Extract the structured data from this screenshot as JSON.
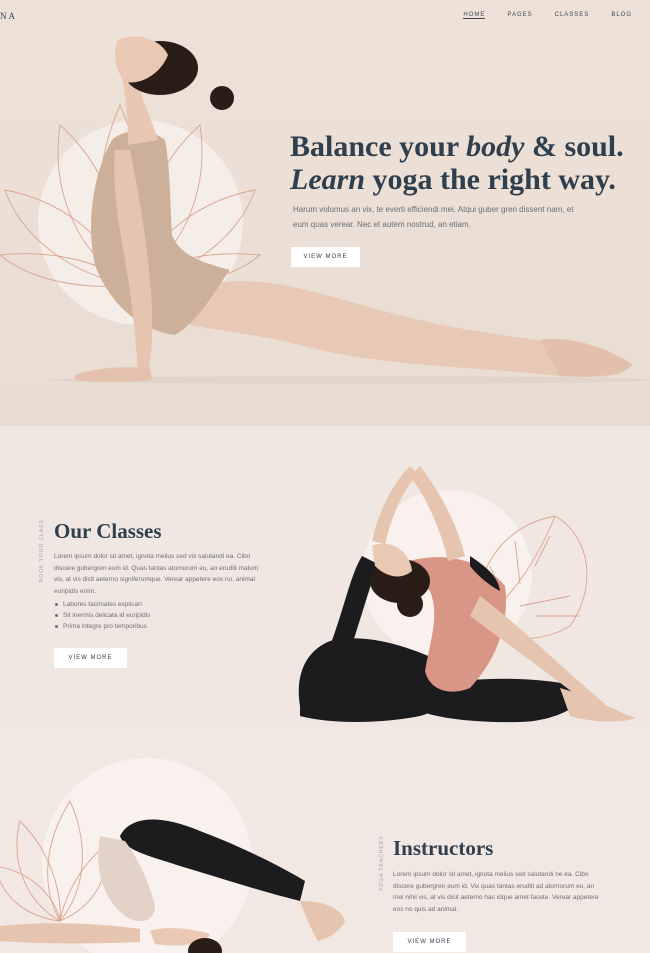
{
  "brand": {
    "fragment": "NA"
  },
  "nav": {
    "items": [
      {
        "label": "HOME",
        "active": true
      },
      {
        "label": "PAGES",
        "active": false
      },
      {
        "label": "CLASSES",
        "active": false
      },
      {
        "label": "BLOG",
        "active": false
      }
    ]
  },
  "hero": {
    "title_line1_a": "Balance your ",
    "title_line1_b": "body",
    "title_line1_c": " & soul.",
    "title_line2_a": "Learn",
    "title_line2_b": " yoga the right way.",
    "text": "Harum volumus an vix, te everti efficiendi mei. Atqui guber gren dissent nam, et eum quas verear. Nec et autem nostrud, an etiam.",
    "button": "VIEW MORE"
  },
  "classes": {
    "vertical_label": "BOOK YOUR CLASS",
    "title": "Our Classes",
    "text": "Lorem ipsum dolor sit amet, ignota melius sed vix salutandi ea. Cibo discere gubergren eum id. Quas tantas atomorum eu, an eruditi malum vis, at vis dicit aeterno signiferumque. Verear appetere eos no, animal euripidis enim.",
    "bullets": [
      "Labores tacimates explicari",
      "Sit inermis delicata id euripidis",
      "Prima integre pro temporibus"
    ],
    "button": "VIEW MORE"
  },
  "instructors": {
    "vertical_label": "YOGA TEACHERS",
    "title": "Instructors",
    "text": "Lorem ipsum dolor sit amet, ignota melius sed salutandi ne ea. Cibo discere gubergren eum id. Vix quas tantas eruditi ad atomorum eu, an mel nihil vis, at vis dicit aeterno has idque amet facete. Verear appetere eos no quis ad animal.",
    "button": "VIEW MORE"
  },
  "colors": {
    "background": "#f1e7e2",
    "hero_background": "#ede1d8",
    "heading": "#2f3f4d",
    "botanical_line": "#d9a48e",
    "accent_top": "#d99585",
    "legging": "#1c1c1e"
  },
  "icons": [
    "lotus-line-art",
    "monstera-leaf-line-art",
    "lotus-line-art"
  ]
}
